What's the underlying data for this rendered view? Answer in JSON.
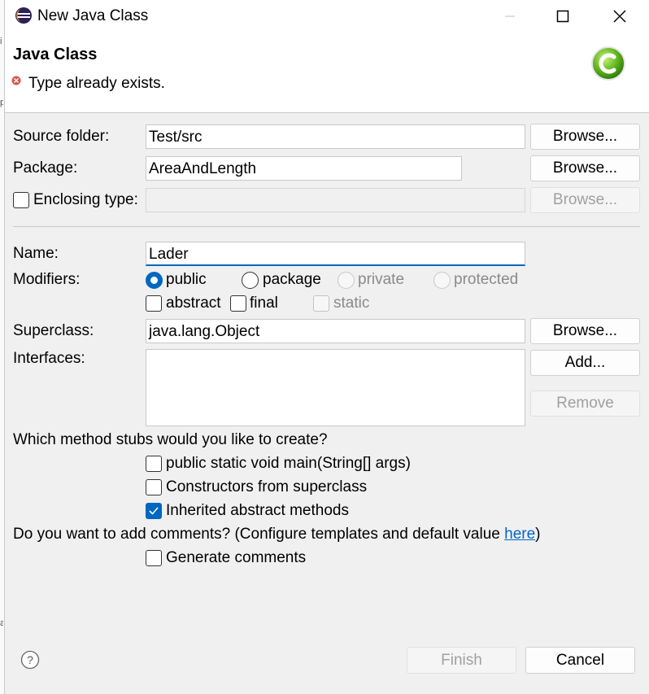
{
  "window": {
    "title": "New Java Class"
  },
  "header": {
    "title": "Java Class",
    "message": "Type already exists."
  },
  "form": {
    "source_folder": {
      "label": "Source folder:",
      "value": "Test/src",
      "button": "Browse..."
    },
    "package": {
      "label": "Package:",
      "value": "AreaAndLength",
      "button": "Browse..."
    },
    "enclosing_type": {
      "label": "Enclosing type:",
      "value": "",
      "button": "Browse...",
      "checked": false
    },
    "name": {
      "label": "Name:",
      "value": "Lader"
    },
    "modifiers": {
      "label": "Modifiers:",
      "options": [
        "public",
        "package",
        "private",
        "protected"
      ],
      "selected": "public",
      "extra": [
        "abstract",
        "final",
        "static"
      ]
    },
    "superclass": {
      "label": "Superclass:",
      "value": "java.lang.Object",
      "button": "Browse..."
    },
    "interfaces": {
      "label": "Interfaces:",
      "add": "Add...",
      "remove": "Remove"
    },
    "stubs": {
      "question": "Which method stubs would you like to create?",
      "main": "public static void main(String[] args)",
      "constructors": "Constructors from superclass",
      "inherited": "Inherited abstract methods",
      "main_checked": false,
      "constructors_checked": false,
      "inherited_checked": true
    },
    "comments": {
      "question_before": "Do you want to add comments? (Configure templates and default value ",
      "link": "here",
      "question_after": ")",
      "generate": "Generate comments",
      "checked": false
    }
  },
  "footer": {
    "finish": "Finish",
    "cancel": "Cancel"
  },
  "colors": {
    "accent": "#0067c0",
    "error": "#d9534f",
    "link": "#0066cc"
  }
}
